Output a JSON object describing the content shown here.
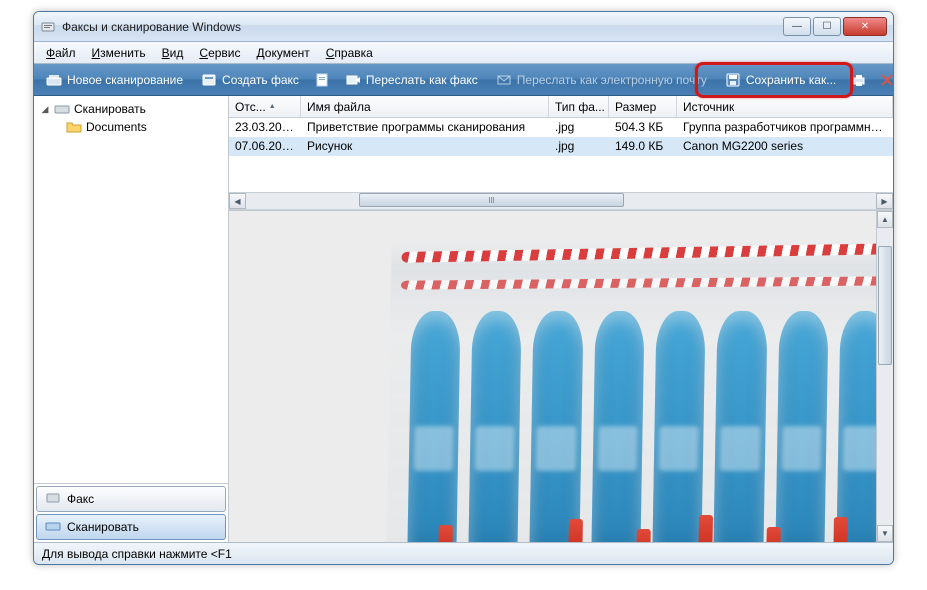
{
  "window": {
    "title": "Факсы и сканирование Windows"
  },
  "menu": {
    "file": "Файл",
    "edit": "Изменить",
    "view": "Вид",
    "service": "Сервис",
    "document": "Документ",
    "help": "Справка"
  },
  "toolbar": {
    "new_scan": "Новое сканирование",
    "new_fax": "Создать факс",
    "forward_fax": "Переслать как факс",
    "forward_email": "Переслать как электронную почту",
    "save_as": "Сохранить как..."
  },
  "sidebar": {
    "root": "Сканировать",
    "child": "Documents",
    "nav_fax": "Факс",
    "nav_scan": "Сканировать"
  },
  "columns": {
    "date": "Отс...",
    "name": "Имя файла",
    "type": "Тип фа...",
    "size": "Размер",
    "source": "Источник"
  },
  "rows": {
    "r1_date": "23.03.201...",
    "r1_name": "Приветствие программы сканирования",
    "r1_type": ".jpg",
    "r1_size": "504.3 КБ",
    "r1_src": "Группа разработчиков программного",
    "r2_date": "07.06.201...",
    "r2_name": "Рисунок",
    "r2_type": ".jpg",
    "r2_size": "149.0 КБ",
    "r2_src": "Canon MG2200 series"
  },
  "statusbar": {
    "text": "Для вывода справки нажмите <F1"
  }
}
